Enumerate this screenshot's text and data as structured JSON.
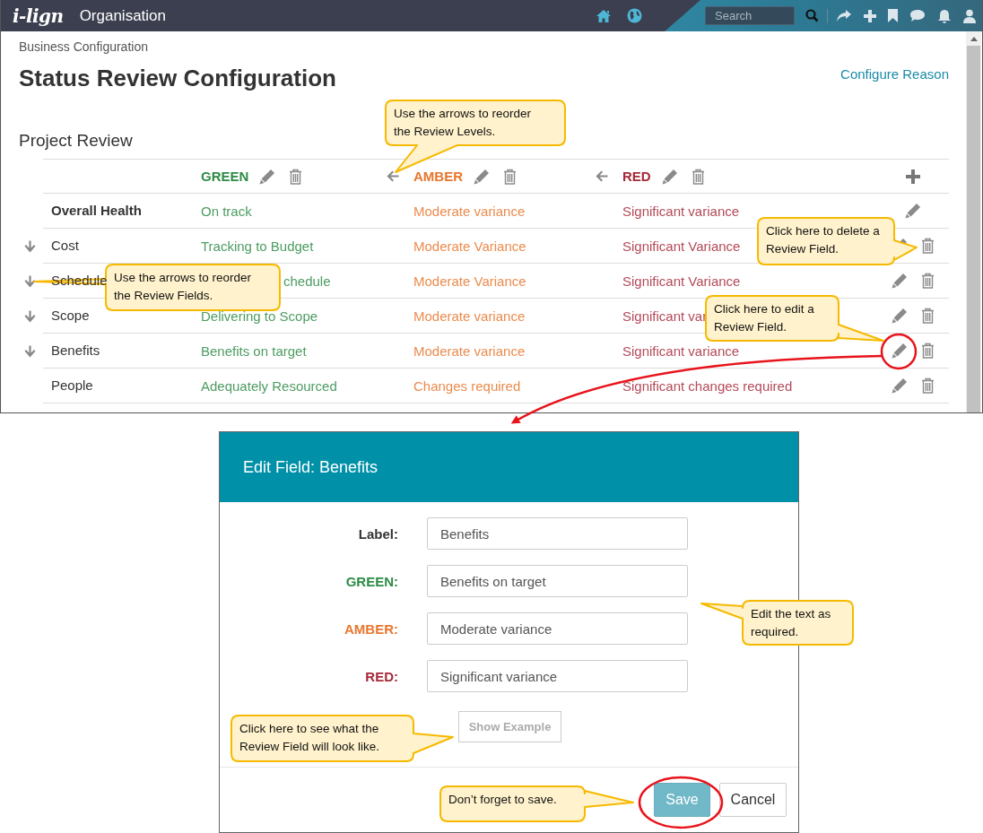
{
  "nav": {
    "logo": "i-lign",
    "title": "Organisation",
    "search": {
      "placeholder": "Search"
    }
  },
  "breadcrumb": "Business Configuration",
  "title": "Status Review Configuration",
  "link": "Configure Reason",
  "section": "Project Review",
  "levels": [
    {
      "name": "GREEN",
      "color": "#2e8b46",
      "movable": false
    },
    {
      "name": "AMBER",
      "color": "#e8762d",
      "movable": true
    },
    {
      "name": "RED",
      "color": "#a52a3a",
      "movable": true
    }
  ],
  "rows": [
    {
      "label": "Overall Health",
      "kind": "summary",
      "movable": false,
      "cells": [
        "On track",
        "Moderate variance",
        "Significant variance"
      ]
    },
    {
      "label": "Cost",
      "kind": "field",
      "movable": true,
      "cells": [
        "Tracking to Budget",
        "Moderate Variance",
        "Significant Variance"
      ]
    },
    {
      "label": "Schedule",
      "kind": "field",
      "movable": true,
      "cells": [
        "chedule",
        "Moderate Variance",
        "Significant Variance"
      ]
    },
    {
      "label": "Scope",
      "kind": "field",
      "movable": true,
      "cells": [
        "Delivering to Scope",
        "Moderate variance",
        "Significant var"
      ]
    },
    {
      "label": "Benefits",
      "kind": "field",
      "movable": true,
      "cells": [
        "Benefits on target",
        "Moderate variance",
        "Significant variance"
      ]
    },
    {
      "label": "People",
      "kind": "field",
      "movable": false,
      "cells": [
        "Adequately Resourced",
        "Changes required",
        "Significant changes required"
      ]
    }
  ],
  "dialog": {
    "title": "Edit Field: Benefits",
    "fields": [
      {
        "label": "Label:",
        "value": "Benefits",
        "color": "#333333"
      },
      {
        "label": "GREEN:",
        "value": "Benefits on target",
        "color": "#2e8b46"
      },
      {
        "label": "AMBER:",
        "value": "Moderate variance",
        "color": "#e8762d"
      },
      {
        "label": "RED:",
        "value": "Significant variance",
        "color": "#a52a3a"
      }
    ],
    "example_button": "Show Example",
    "buttons": [
      {
        "label": "Save",
        "kind": "primary"
      },
      {
        "label": "Cancel",
        "kind": "default"
      }
    ]
  },
  "callouts": [
    {
      "text": "Use the arrows to reorder the Review Levels."
    },
    {
      "text": "Use the arrows to reorder the Review Fields."
    },
    {
      "text": "Click here to delete a Review Field."
    },
    {
      "text": "Click here to edit a Review Field."
    },
    {
      "text": "Edit the text as required."
    },
    {
      "text": "Click here to see what the Review Field will look like."
    },
    {
      "text": "Don’t forget to save."
    }
  ]
}
